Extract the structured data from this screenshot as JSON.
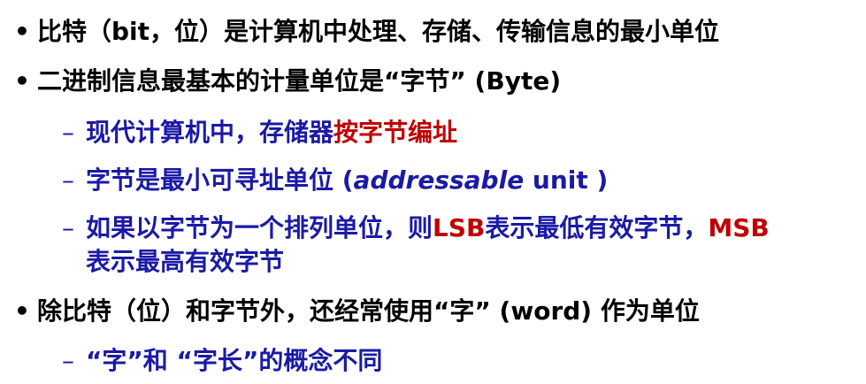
{
  "items": [
    {
      "level": 1,
      "segments": [
        {
          "text": "比特（bit，位）是计算机中处理、存储、传输信息的最小单位"
        }
      ]
    },
    {
      "level": 1,
      "segments": [
        {
          "text": "二进制信息最基本的计量单位是“字节” (Byte)"
        }
      ]
    },
    {
      "level": 2,
      "segments": [
        {
          "text": "现代计算机中，存储器"
        },
        {
          "text": "按字节编址",
          "color": "red"
        }
      ]
    },
    {
      "level": 2,
      "segments": [
        {
          "text": "字节是最小可寻址单位 ("
        },
        {
          "text": "addressable",
          "style": "italic"
        },
        {
          "text": " unit )"
        }
      ]
    },
    {
      "level": 2,
      "segments": [
        {
          "text": "如果以字节为一个排列单位，则"
        },
        {
          "text": "LSB",
          "color": "red"
        },
        {
          "text": "表示最低有效字节，"
        },
        {
          "text": "MSB",
          "color": "red"
        }
      ],
      "continuation": "表示最高有效字节"
    },
    {
      "level": 1,
      "segments": [
        {
          "text": "除比特（位）和字节外，还经常使用“字” (word) 作为单位"
        }
      ]
    },
    {
      "level": 2,
      "segments": [
        {
          "text": "“字”和 “字长”的概念不同"
        }
      ]
    }
  ],
  "colors": {
    "level1": "#000000",
    "level2": "#1a1aa6",
    "highlight": "#c00000"
  },
  "bullet_glyph": "•",
  "dash_glyph": "–"
}
